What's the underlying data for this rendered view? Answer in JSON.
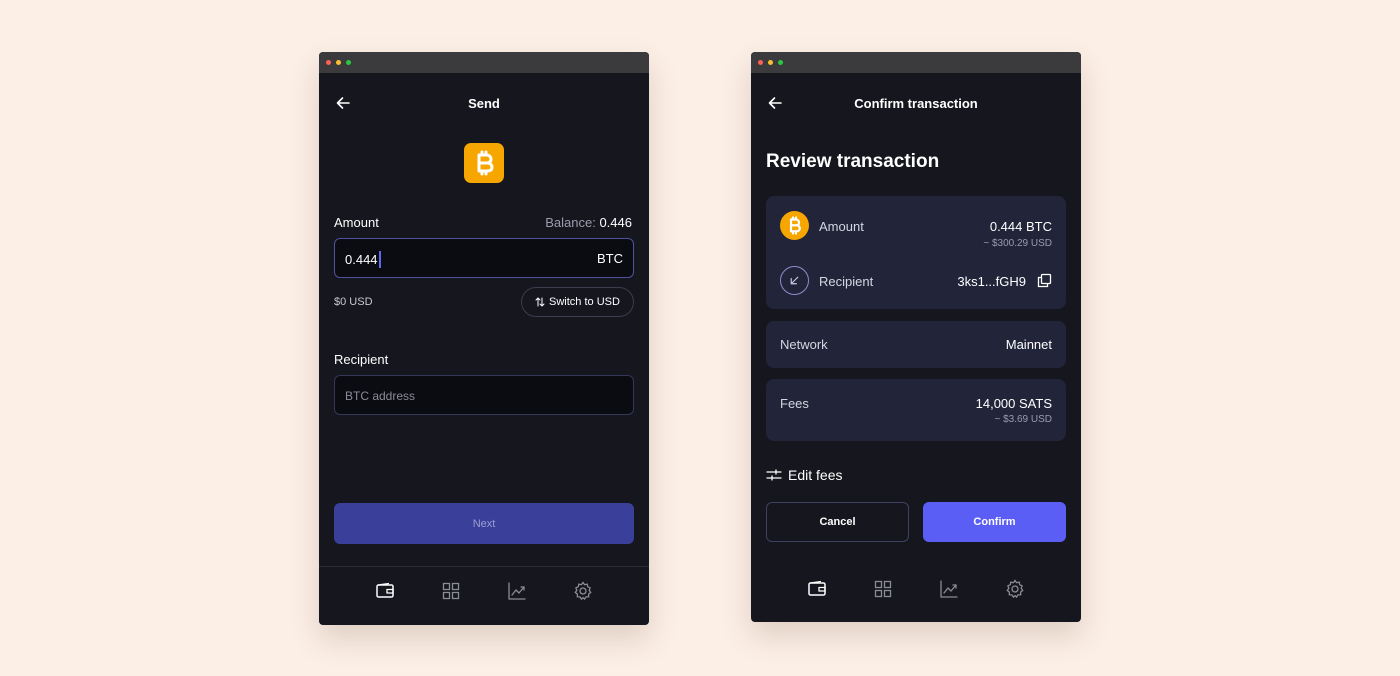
{
  "colors": {
    "background": "#fcefe6",
    "window": "#15161e",
    "accent": "#5b5ef5",
    "bitcoin": "#f7a600"
  },
  "send": {
    "title": "Send",
    "amount_label": "Amount",
    "balance_label": "Balance:",
    "balance_value": "0.446",
    "amount_value": "0.444",
    "amount_unit": "BTC",
    "usd_value": "$0 USD",
    "switch_label": "Switch to USD",
    "recipient_label": "Recipient",
    "recipient_placeholder": "BTC address",
    "next_label": "Next"
  },
  "confirm": {
    "title": "Confirm transaction",
    "review_title": "Review transaction",
    "amount_label": "Amount",
    "amount_value": "0.444 BTC",
    "amount_usd": "~ $300.29 USD",
    "recipient_label": "Recipient",
    "recipient_value": "3ks1...fGH9",
    "network_label": "Network",
    "network_value": "Mainnet",
    "fees_label": "Fees",
    "fees_value": "14,000 SATS",
    "fees_usd": "~ $3.69 USD",
    "edit_fees_label": "Edit fees",
    "cancel_label": "Cancel",
    "confirm_label": "Confirm"
  },
  "nav": {
    "icons": [
      "wallet-icon",
      "grid-icon",
      "chart-icon",
      "gear-icon"
    ],
    "active": "wallet-icon"
  }
}
